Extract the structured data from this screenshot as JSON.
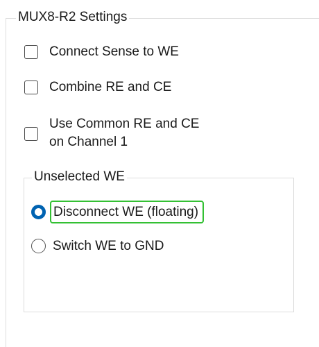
{
  "settings": {
    "title": "MUX8-R2 Settings",
    "checkboxes": [
      {
        "label": "Connect Sense to WE",
        "checked": false
      },
      {
        "label": "Combine RE and CE",
        "checked": false
      },
      {
        "label_line1": "Use Common RE and CE",
        "label_line2": "on Channel 1",
        "checked": false
      }
    ]
  },
  "unselected_we": {
    "title": "Unselected WE",
    "options": [
      {
        "label": "Disconnect WE (floating)",
        "selected": true
      },
      {
        "label": "Switch WE to GND",
        "selected": false
      }
    ]
  },
  "colors": {
    "radio_selected": "#0063b1",
    "focus_outline": "#33c033"
  }
}
